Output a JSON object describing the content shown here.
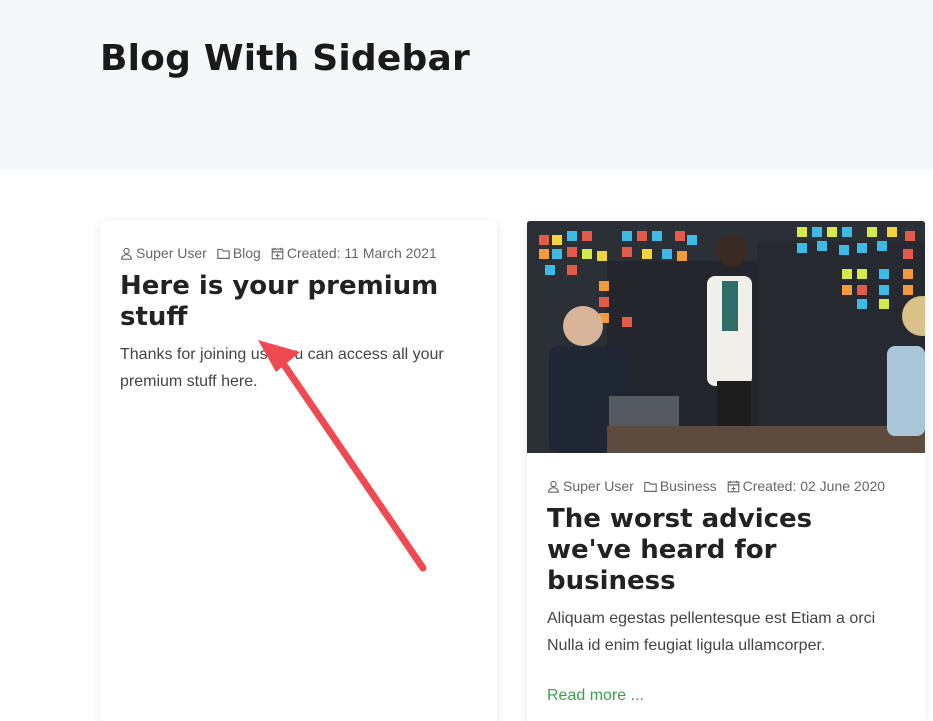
{
  "page": {
    "title": "Blog With Sidebar"
  },
  "posts": [
    {
      "author": "Super User",
      "category": "Blog",
      "created": "Created: 11 March 2021",
      "title": "Here is your premium stuff",
      "excerpt": "Thanks for joining us. You can access all your premium stuff here."
    },
    {
      "author": "Super User",
      "category": "Business",
      "created": "Created: 02 June 2020",
      "title": "The worst advices we've heard for business",
      "excerpt": "Aliquam egestas pellentesque est Etiam a orci Nulla id enim feugiat ligula ullamcorper.",
      "read_more": "Read more ..."
    }
  ],
  "colors": {
    "accent_link": "#3aa04b",
    "annotation_arrow": "#ef4a53",
    "header_bg": "#f6f7f9"
  },
  "icons": [
    "user-icon",
    "folder-icon",
    "calendar-icon"
  ]
}
